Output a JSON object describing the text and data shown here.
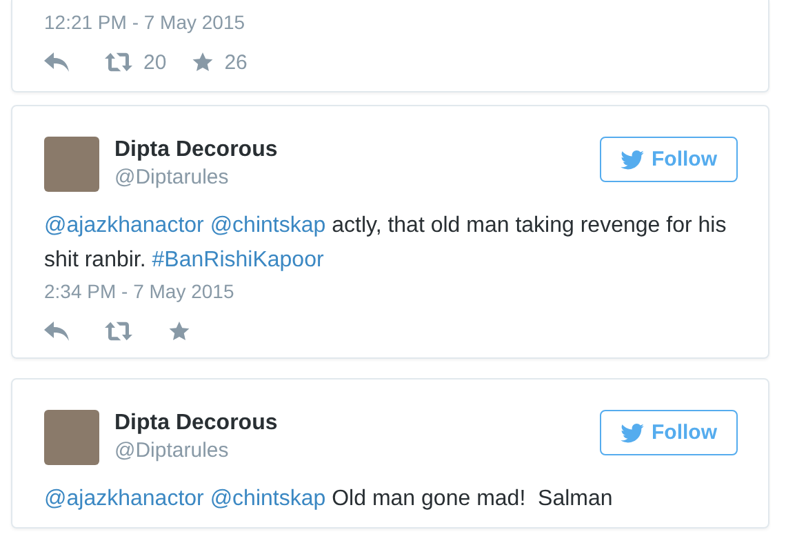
{
  "tweets": [
    {
      "partial": true,
      "time": "12:21 PM - 7 May 2015",
      "retweets": "20",
      "favorites": "26"
    },
    {
      "partial": false,
      "name": "Dipta Decorous",
      "handle": "@Diptarules",
      "follow": "Follow",
      "segments": [
        {
          "kind": "mention",
          "text": "@ajazkhanactor"
        },
        {
          "kind": "mention",
          "text": "@chintskap"
        },
        {
          "kind": "plain",
          "text": "actly, that old man taking revenge for his shit ranbir."
        },
        {
          "kind": "hashtag",
          "text": "#BanRishiKapoor"
        }
      ],
      "time": "2:34 PM - 7 May 2015"
    },
    {
      "partial": false,
      "name": "Dipta Decorous",
      "handle": "@Diptarules",
      "follow": "Follow",
      "segments": [
        {
          "kind": "mention",
          "text": "@ajazkhanactor"
        },
        {
          "kind": "mention",
          "text": "@chintskap"
        },
        {
          "kind": "plain",
          "text": "Old man gone mad!  Salman"
        }
      ]
    }
  ]
}
